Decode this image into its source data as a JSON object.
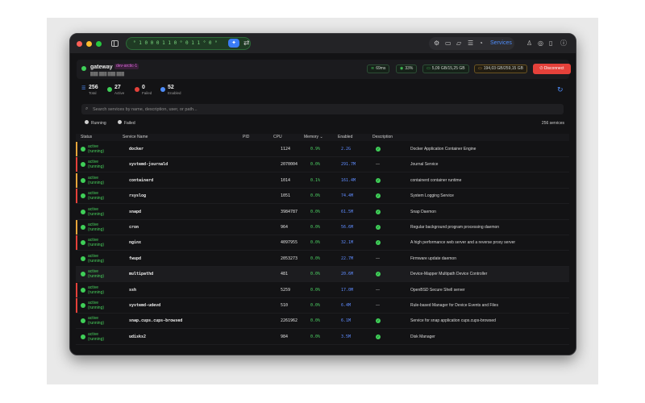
{
  "window": {
    "traffic_lights": {
      "close": "#fe5f57",
      "minimize": "#febc2e",
      "maximize": "#28c840"
    },
    "url_text": "° 1 0 0 0 1 1 0 ° 0 1 1 ° 0 °",
    "toolbar_icons": [
      "settings-icon",
      "terminal-icon",
      "folder-icon",
      "list-icon",
      "gauge-icon",
      "services-icon"
    ],
    "services_label": "Services",
    "right_icons": [
      "user-icon",
      "globe-icon",
      "clipboard-icon",
      "info-icon"
    ]
  },
  "host": {
    "name": "gateway",
    "tag": "dev-arctic-1",
    "subtitle": "███ ███ ███ ███",
    "latency": "69ms",
    "cpu": "33%",
    "memory": "5,09 GB/15,25 GB",
    "disk": "194,03 GB/259,15 GB",
    "disconnect_label": "Disconnect"
  },
  "stats": [
    {
      "value": "256",
      "label": "Total",
      "color": "none"
    },
    {
      "value": "27",
      "label": "Active",
      "color": "#3fcf58"
    },
    {
      "value": "0",
      "label": "Failed",
      "color": "#e5413a"
    },
    {
      "value": "52",
      "label": "Enabled",
      "color": "#4e8dfb"
    }
  ],
  "search": {
    "placeholder": "Search services by name, description, user, or path..."
  },
  "filters": {
    "running": "Running",
    "failed": "Failed"
  },
  "service_count": "256 services",
  "table": {
    "headers": {
      "status": "Status",
      "name": "Service Name",
      "pid": "PID",
      "cpu": "CPU",
      "memory": "Memory ⌄",
      "enabled": "Enabled",
      "description": "Description"
    },
    "rows": [
      {
        "status": "active (running)",
        "name": "docker",
        "pid": "1124",
        "cpu": "0.9%",
        "mem": "2.2G",
        "enabled": true,
        "desc": "Docker Application Container Engine",
        "bar": "#e6a53a"
      },
      {
        "status": "active (running)",
        "name": "systemd-journald",
        "pid": "2070004",
        "cpu": "0.0%",
        "mem": "291.7M",
        "enabled": false,
        "desc": "Journal Service",
        "bar": "#e5413a"
      },
      {
        "status": "active (running)",
        "name": "containerd",
        "pid": "1014",
        "cpu": "0.1%",
        "mem": "161.4M",
        "enabled": true,
        "desc": "containerd container runtime",
        "bar": "#e6a53a"
      },
      {
        "status": "active (running)",
        "name": "rsyslog",
        "pid": "1051",
        "cpu": "0.0%",
        "mem": "74.4M",
        "enabled": true,
        "desc": "System Logging Service",
        "bar": "#e5413a"
      },
      {
        "status": "active (running)",
        "name": "snapd",
        "pid": "3984787",
        "cpu": "0.0%",
        "mem": "61.5M",
        "enabled": true,
        "desc": "Snap Daemon",
        "bar": "none"
      },
      {
        "status": "active (running)",
        "name": "cron",
        "pid": "964",
        "cpu": "0.0%",
        "mem": "56.6M",
        "enabled": true,
        "desc": "Regular background program processing daemon",
        "bar": "#e6a53a"
      },
      {
        "status": "active (running)",
        "name": "nginx",
        "pid": "4097955",
        "cpu": "0.0%",
        "mem": "32.1M",
        "enabled": true,
        "desc": "A high performance web server and a reverse proxy server",
        "bar": "#e5413a"
      },
      {
        "status": "active (running)",
        "name": "fwupd",
        "pid": "2053273",
        "cpu": "0.0%",
        "mem": "22.7M",
        "enabled": false,
        "desc": "Firmware update daemon",
        "bar": "none"
      },
      {
        "status": "active (running)",
        "name": "multipathd",
        "pid": "481",
        "cpu": "0.0%",
        "mem": "20.6M",
        "enabled": true,
        "desc": "Device-Mapper Multipath Device Controller",
        "bar": "none"
      },
      {
        "status": "active (running)",
        "name": "ssh",
        "pid": "5259",
        "cpu": "0.0%",
        "mem": "17.0M",
        "enabled": false,
        "desc": "OpenBSD Secure Shell server",
        "bar": "#e5413a"
      },
      {
        "status": "active (running)",
        "name": "systemd-udevd",
        "pid": "510",
        "cpu": "0.0%",
        "mem": "6.4M",
        "enabled": false,
        "desc": "Rule-based Manager for Device Events and Files",
        "bar": "#e5413a"
      },
      {
        "status": "active (running)",
        "name": "snap.cups.cups-browsed",
        "pid": "2261962",
        "cpu": "0.0%",
        "mem": "6.1M",
        "enabled": true,
        "desc": "Service for snap application cups.cups-browsed",
        "bar": "none"
      },
      {
        "status": "active (running)",
        "name": "udisks2",
        "pid": "984",
        "cpu": "0.0%",
        "mem": "3.5M",
        "enabled": true,
        "desc": "Disk Manager",
        "bar": "none"
      }
    ],
    "highlighted_row": 8
  }
}
